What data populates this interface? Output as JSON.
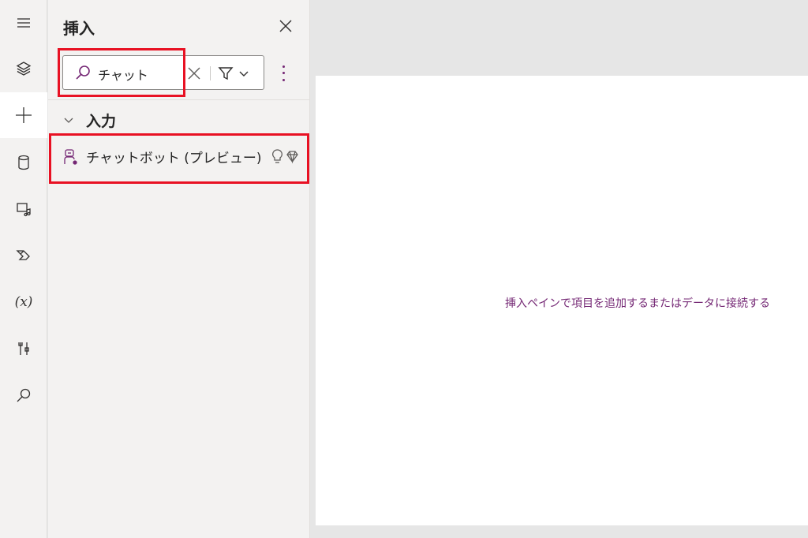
{
  "rail": {
    "items": [
      {
        "name": "hamburger-menu",
        "icon": "hamburger-icon"
      },
      {
        "name": "tree-view",
        "icon": "layers-icon"
      },
      {
        "name": "insert",
        "icon": "plus-icon",
        "active": true
      },
      {
        "name": "data",
        "icon": "database-icon"
      },
      {
        "name": "media",
        "icon": "media-icon"
      },
      {
        "name": "power-automate",
        "icon": "power-automate-icon"
      },
      {
        "name": "variables",
        "icon": "variable-icon",
        "label": "(x)"
      },
      {
        "name": "advanced-tools",
        "icon": "tools-icon"
      },
      {
        "name": "search",
        "icon": "search-icon"
      }
    ]
  },
  "panel": {
    "title": "挿入",
    "search": {
      "value": "チャット"
    },
    "group": {
      "label": "入力",
      "expanded": true
    },
    "items": [
      {
        "label": "チャットボット (プレビュー)",
        "icon": "chatbot-icon",
        "badges": [
          "lightbulb-icon",
          "premium-diamond-icon"
        ]
      }
    ]
  },
  "canvas": {
    "hint": "挿入ペインで項目を追加するまたはデータに接続する"
  },
  "colors": {
    "accent": "#742774",
    "highlight": "#e81123",
    "panel_bg": "#f3f2f1",
    "canvas_bg": "#ffffff",
    "backdrop": "#e6e6e6"
  }
}
